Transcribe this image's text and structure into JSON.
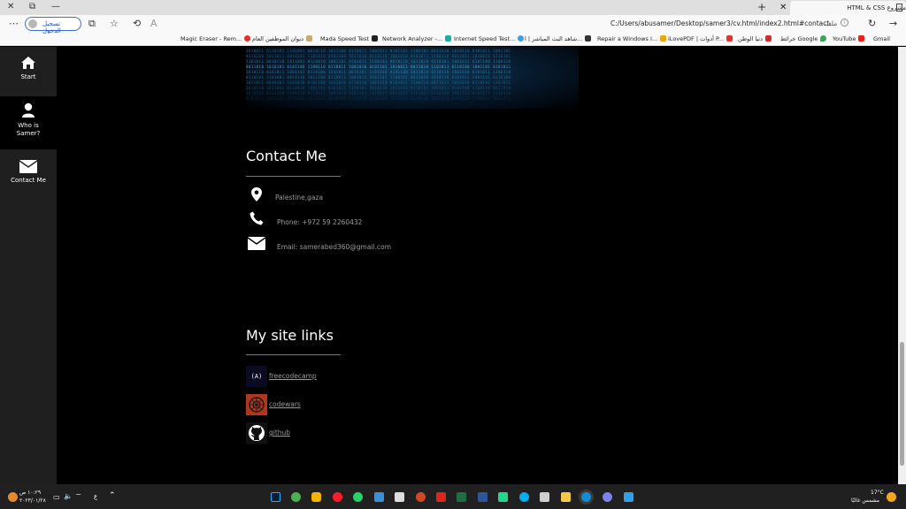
{
  "browser": {
    "tab_title": "مشروع HTML & CSS",
    "new_tab": "+",
    "signin_label": "تسجيل الدخول",
    "file_label": "ملف",
    "url": "C:/Users/abusamer/Desktop/samer3/cv.html/index2.html#contact",
    "bookmarks": [
      "Gmail",
      "YouTube",
      "خرائط Google",
      "دنيا الوطن",
      "iLovePDF | أدوات P...",
      "Repair a Windows I...",
      "شاهد البث المباشر | ا...",
      "Internet Speed Test...",
      "Network Analyzer -...",
      "Mada Speed Test",
      "ديوان الموظفين العام",
      "Magic Eraser - Rem..."
    ]
  },
  "sidebar": {
    "items": [
      {
        "label": "Start",
        "icon": "home-icon"
      },
      {
        "label": "Who is Samer?",
        "icon": "user-icon"
      },
      {
        "label": "Contact Me",
        "icon": "envelope-icon"
      }
    ]
  },
  "contact": {
    "heading": "Contact Me",
    "location": "Palestine,gaza",
    "phone": "Phone: +972 59 2260432",
    "email": "Email: samerabed360@gmail.com"
  },
  "links": {
    "heading": "My site links",
    "items": [
      {
        "label": "freecodecamp",
        "logo_text": "(A)"
      },
      {
        "label": "codewars"
      },
      {
        "label": "github"
      }
    ]
  },
  "taskbar": {
    "weather_temp": "17°C",
    "weather_desc": "مشمس غالبًا",
    "time": "١٠:٢٩ ص",
    "date": "٢٠٢٣/٠١/٢٨",
    "lang": "ع"
  },
  "colors": {
    "page_bg": "#000000",
    "sidebar_bg": "#1f1f1f",
    "text_muted": "#9a9a9a",
    "codewars_red": "#b1361e"
  }
}
